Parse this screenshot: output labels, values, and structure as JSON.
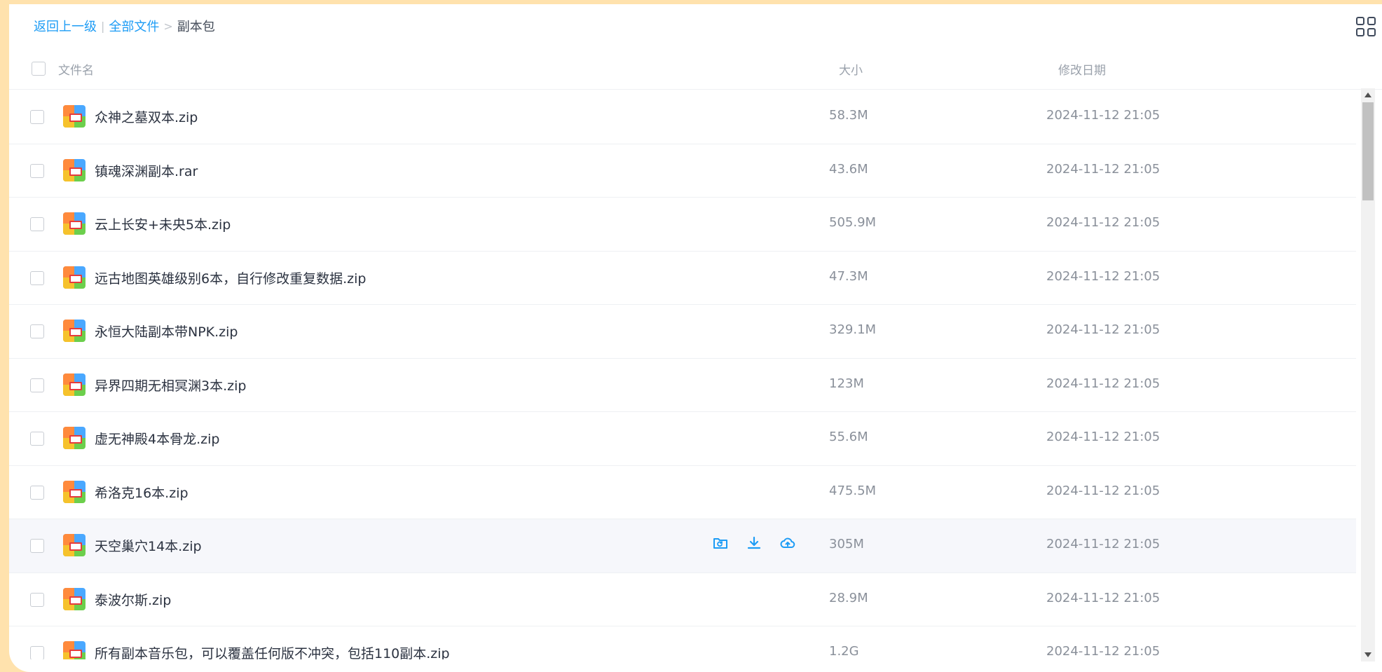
{
  "breadcrumb": {
    "back": "返回上一级",
    "separator": "|",
    "all_files": "全部文件",
    "arrow": ">",
    "current": "副本包"
  },
  "columns": {
    "name": "文件名",
    "size": "大小",
    "modified": "修改日期"
  },
  "files": [
    {
      "name": "众神之墓双本.zip",
      "size": "58.3M",
      "date": "2024-11-12 21:05"
    },
    {
      "name": "镇魂深渊副本.rar",
      "size": "43.6M",
      "date": "2024-11-12 21:05"
    },
    {
      "name": "云上长安+未央5本.zip",
      "size": "505.9M",
      "date": "2024-11-12 21:05"
    },
    {
      "name": "远古地图英雄级别6本，自行修改重复数据.zip",
      "size": "47.3M",
      "date": "2024-11-12 21:05"
    },
    {
      "name": "永恒大陆副本带NPK.zip",
      "size": "329.1M",
      "date": "2024-11-12 21:05"
    },
    {
      "name": "异界四期无相冥渊3本.zip",
      "size": "123M",
      "date": "2024-11-12 21:05"
    },
    {
      "name": "虚无神殿4本骨龙.zip",
      "size": "55.6M",
      "date": "2024-11-12 21:05"
    },
    {
      "name": "希洛克16本.zip",
      "size": "475.5M",
      "date": "2024-11-12 21:05"
    },
    {
      "name": "天空巢穴14本.zip",
      "size": "305M",
      "date": "2024-11-12 21:05"
    },
    {
      "name": "泰波尔斯.zip",
      "size": "28.9M",
      "date": "2024-11-12 21:05"
    },
    {
      "name": "所有副本音乐包，可以覆盖任何版不冲突，包括110副本.zip",
      "size": "1.2G",
      "date": "2024-11-12 21:05"
    }
  ],
  "hovered_row_index": 8,
  "colors": {
    "accent": "#1d9cf5",
    "background": "#ffe2ad",
    "hover_row": "#f6f7fb"
  }
}
